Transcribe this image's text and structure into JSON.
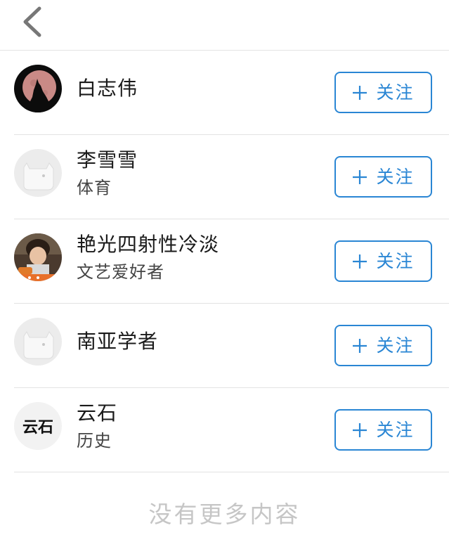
{
  "header": {
    "back_icon": "chevron-left-icon"
  },
  "follow_label": "关注",
  "users": [
    {
      "name": "白志伟",
      "subtitle": "",
      "avatar": "wolf-moon-avatar"
    },
    {
      "name": "李雪雪",
      "subtitle": "体育",
      "avatar": "default-avatar"
    },
    {
      "name": "艳光四射性冷淡",
      "subtitle": "文艺爱好者",
      "avatar": "photo-avatar"
    },
    {
      "name": "南亚学者",
      "subtitle": "",
      "avatar": "default-avatar"
    },
    {
      "name": "云石",
      "subtitle": "历史",
      "avatar": "text-avatar",
      "avatar_text": "云石"
    }
  ],
  "footer": {
    "no_more": "没有更多内容"
  },
  "colors": {
    "accent": "#2a86d4",
    "divider": "#e3e3e3",
    "footer_text": "#c6c6c6"
  }
}
